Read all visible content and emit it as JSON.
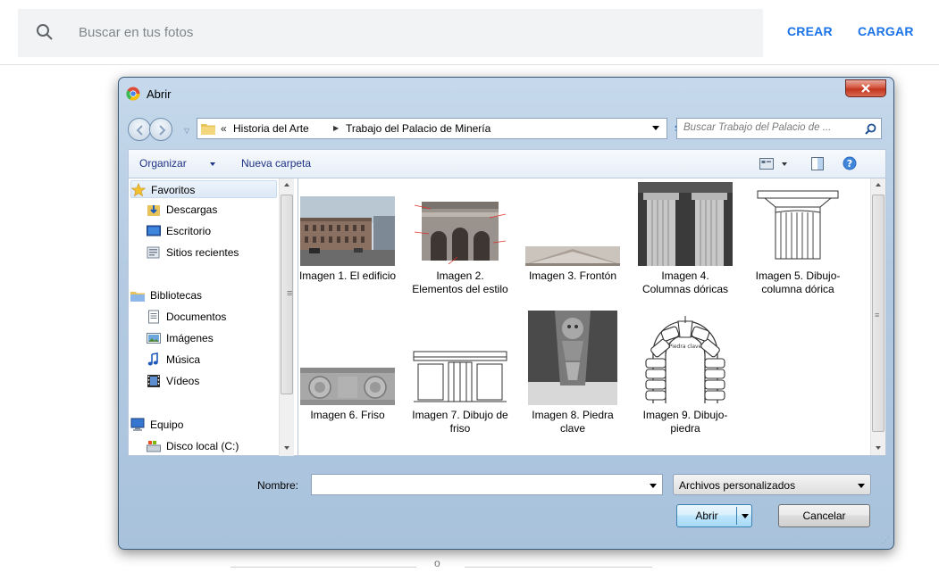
{
  "topbar": {
    "search_placeholder": "Buscar en tus fotos",
    "crear": "CREAR",
    "cargar": "CARGAR",
    "accent": "#1a73e8"
  },
  "footer": {
    "text": "o"
  },
  "dialog": {
    "title": "Abrir",
    "address": {
      "overflow": "«",
      "crumbs": [
        "Historia del Arte",
        "Trabajo del Palacio de Minería"
      ]
    },
    "search_placeholder": "Buscar Trabajo del Palacio de ...",
    "toolbar": {
      "organize": "Organizar",
      "new_folder": "Nueva carpeta"
    },
    "nav": {
      "favorites": "Favoritos",
      "downloads": "Descargas",
      "desktop": "Escritorio",
      "recent": "Sitios recientes",
      "libraries": "Bibliotecas",
      "documents": "Documentos",
      "pictures": "Imágenes",
      "music": "Música",
      "videos": "Vídeos",
      "computer": "Equipo",
      "local_disk": "Disco local (C:)"
    },
    "files": [
      {
        "label": "Imagen 1. El edificio",
        "icon": "photo-building"
      },
      {
        "label": "Imagen 2. Elementos del estilo",
        "icon": "photo-facade"
      },
      {
        "label": "Imagen 3. Frontón",
        "icon": "photo-pediment"
      },
      {
        "label": "Imagen 4. Columnas dóricas",
        "icon": "photo-columns"
      },
      {
        "label": "Imagen 5. Dibujo-columna dórica",
        "icon": "drawing-column"
      },
      {
        "label": "Imagen 6. Friso",
        "icon": "photo-frieze"
      },
      {
        "label": "Imagen 7. Dibujo de friso",
        "icon": "drawing-frieze"
      },
      {
        "label": "Imagen 8. Piedra clave",
        "icon": "photo-keystone"
      },
      {
        "label": "Imagen 9. Dibujo-piedra",
        "icon": "drawing-keystone",
        "inner_label": "Piedra clave"
      }
    ],
    "name_label": "Nombre:",
    "name_value": "",
    "filter": "Archivos personalizados",
    "open": "Abrir",
    "cancel": "Cancelar"
  }
}
